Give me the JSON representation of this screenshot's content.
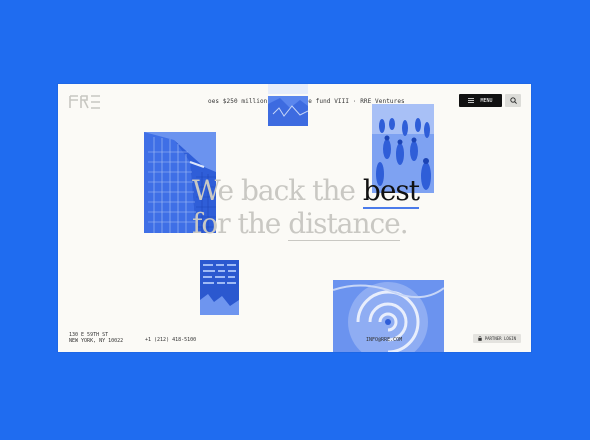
{
  "header": {
    "ticker_text": "oes $250 million early-stage fund VIII · RRE Ventures",
    "menu_label": "MENU",
    "logo_alt": "RRE"
  },
  "headline": {
    "line1_light": "We back the ",
    "line1_bold": "best",
    "line2_pre": "for the ",
    "line2_underlined": "distance",
    "line2_post": "."
  },
  "footer": {
    "address_line1": "130 E 59TH ST",
    "address_line2": "NEW YORK, NY 10022",
    "phone": "+1 (212) 418-5100",
    "email": "INFO@RRE.COM",
    "partner_login": "PARTNER LOGIN"
  },
  "colors": {
    "background": "#1f6cf0",
    "card": "#fbfaf6",
    "image_tint": "#3c6ee8"
  }
}
